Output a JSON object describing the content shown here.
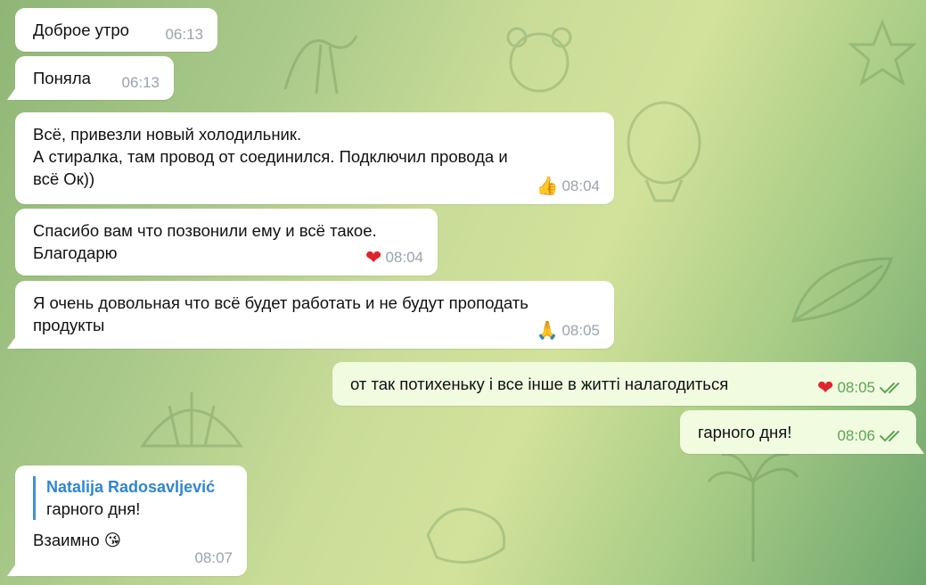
{
  "colors": {
    "incoming_bubble": "#ffffff",
    "outgoing_bubble": "#f1fbe0",
    "reply_accent": "#3f8fd8",
    "outgoing_time": "#5ca553",
    "heart": "#e0242c"
  },
  "messages": [
    {
      "id": "m1",
      "direction": "in",
      "text": "Доброе утро",
      "time": "06:13"
    },
    {
      "id": "m2",
      "direction": "in",
      "text": "Поняла",
      "time": "06:13"
    },
    {
      "id": "m3",
      "direction": "in",
      "lines": [
        "Всё, привезли новый холодильник.",
        "А стиралка, там провод от соединился. Подключил провода и",
        "всё Ок))"
      ],
      "reaction": "👍",
      "time": "08:04"
    },
    {
      "id": "m4",
      "direction": "in",
      "lines": [
        "Спасибо вам что позвонили ему и всё такое.",
        "Благодарю"
      ],
      "reaction": "❤",
      "time": "08:04"
    },
    {
      "id": "m5",
      "direction": "in",
      "lines": [
        "Я очень довольная что всё будет работать и не будут проподать",
        "продукты"
      ],
      "reaction": "🙏",
      "time": "08:05"
    },
    {
      "id": "m6",
      "direction": "out",
      "text": "от так потихеньку і все інше в житті налагодиться",
      "reaction": "❤",
      "time": "08:05",
      "status": "read-double-check-icon"
    },
    {
      "id": "m7",
      "direction": "out",
      "text": "гарного дня!",
      "time": "08:06",
      "status": "read-double-check-icon"
    },
    {
      "id": "m8",
      "direction": "in",
      "reply_to": {
        "author": "Natalija Radosavljević",
        "text": "гарного дня!"
      },
      "text": "Взаимно 😘",
      "time": "08:07"
    }
  ]
}
